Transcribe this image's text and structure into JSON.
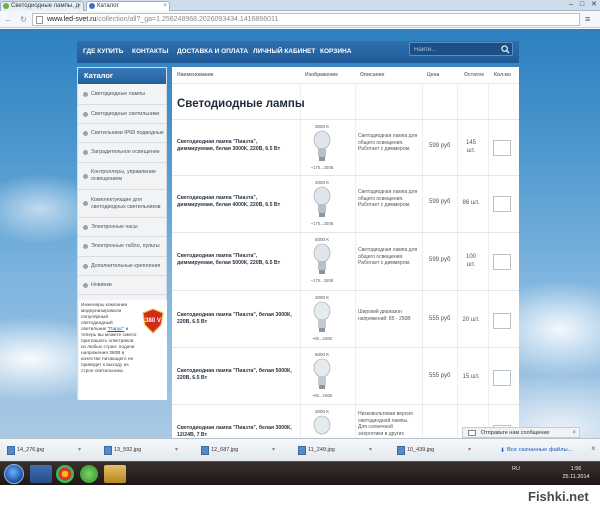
{
  "browser": {
    "tabs": [
      {
        "title": "Светодиодные лампы, д"
      },
      {
        "title": "Каталог"
      }
    ],
    "url_host": "www.led-svet.ru",
    "url_rest": "/collection/all?_ga=1.256248968.2026093434.1416866011",
    "window_controls": [
      "–",
      "□",
      "✕"
    ]
  },
  "site": {
    "nav": [
      "ГДЕ КУПИТЬ",
      "КОНТАКТЫ",
      "ДОСТАВКА И ОПЛАТА",
      "ЛИЧНЫЙ КАБИНЕТ",
      "КОРЗИНА"
    ],
    "search_placeholder": "Найти..."
  },
  "sidebar": {
    "title": "Каталог",
    "items": [
      "Светодиодные лампы",
      "Светодиодные светильники",
      "Светильники IP68 подводные",
      "Заградительное освещение",
      "Контроллеры, управление освещением",
      "Комплектующие для светодиодных светильников",
      "Электронные часы",
      "Электронные табло, пульты",
      "Дополнительные крепления",
      "Новинки"
    ],
    "promo": {
      "text_before": "Инженеры компании модернизировали популярный светодиодный светильник",
      "link": "\"Парус\"",
      "text_after": "и теперь вы можете смело приглашать электриков из любых стран: подачи напряжения 380В в качестве питающего не приведет к выходу из строя светильника.",
      "badge": "380 V"
    }
  },
  "table": {
    "headers": [
      "Наименование",
      "Изображение",
      "Описание",
      "Цена",
      "Остаток",
      "Кол-во"
    ],
    "title": "Светодиодные лампы",
    "rows": [
      {
        "name": "Светодиодная лампа \"Пиазта\", диммируемая, белая 3000К, 220В, 6.5 Вт",
        "temp": "3000 К",
        "range": "~175...250В",
        "desc": "Светодиодная лампа для общего освещения. Работает с диммером.",
        "price": "599 руб",
        "stock": "145 шт."
      },
      {
        "name": "Светодиодная лампа \"Пиазта\", диммируемая, белая 4000К, 220В, 6.5 Вт",
        "temp": "4000 К",
        "range": "~175...250В",
        "desc": "Светодиодная лампа для общего освещения. Работает с диммером.",
        "price": "599 руб",
        "stock": "86 шт."
      },
      {
        "name": "Светодиодная лампа \"Пиазта\", диммируемая, белая 5000К, 220В, 6.5 Вт",
        "temp": "5000 К",
        "range": "~175...250В",
        "desc": "Светодиодная лампа для общего освещения. Работает с диммером.",
        "price": "599 руб",
        "stock": "100 шт."
      },
      {
        "name": "Светодиодная лампа \"Пиазта\", белая 3000К, 220В, 6.5 Вт",
        "temp": "3000 К",
        "range": "~85...250В",
        "desc": "Широкий диапазон напряжений: 85 - 250В",
        "price": "555 руб",
        "stock": "20 шт."
      },
      {
        "name": "Светодиодная лампа \"Пиазта\", белая 5000К, 220В, 6.5 Вт",
        "temp": "5000 К",
        "range": "~85...250В",
        "desc": "",
        "price": "555 руб",
        "stock": "15 шт."
      },
      {
        "name": "Светодиодная лампа \"Пиазта\", белая 3000К, 12/24В, 7 Вт",
        "temp": "3000 К",
        "range": "",
        "desc": "Низковольтовая версия светодиодной лампы. Для солнечной энергетики в других",
        "price": "",
        "stock": ""
      }
    ]
  },
  "toast": {
    "text": "Отправьте нам сообщение"
  },
  "downloads": {
    "files": [
      "14_276.jpg",
      "13_592.jpg",
      "12_687.jpg",
      "11_249.jpg",
      "10_439.jpg"
    ],
    "show_all": "Все скачанные файлы..."
  },
  "taskbar": {
    "lang": "RU",
    "time": "1:56",
    "date": "25.11.2014"
  },
  "watermark": "Fishki.net"
}
